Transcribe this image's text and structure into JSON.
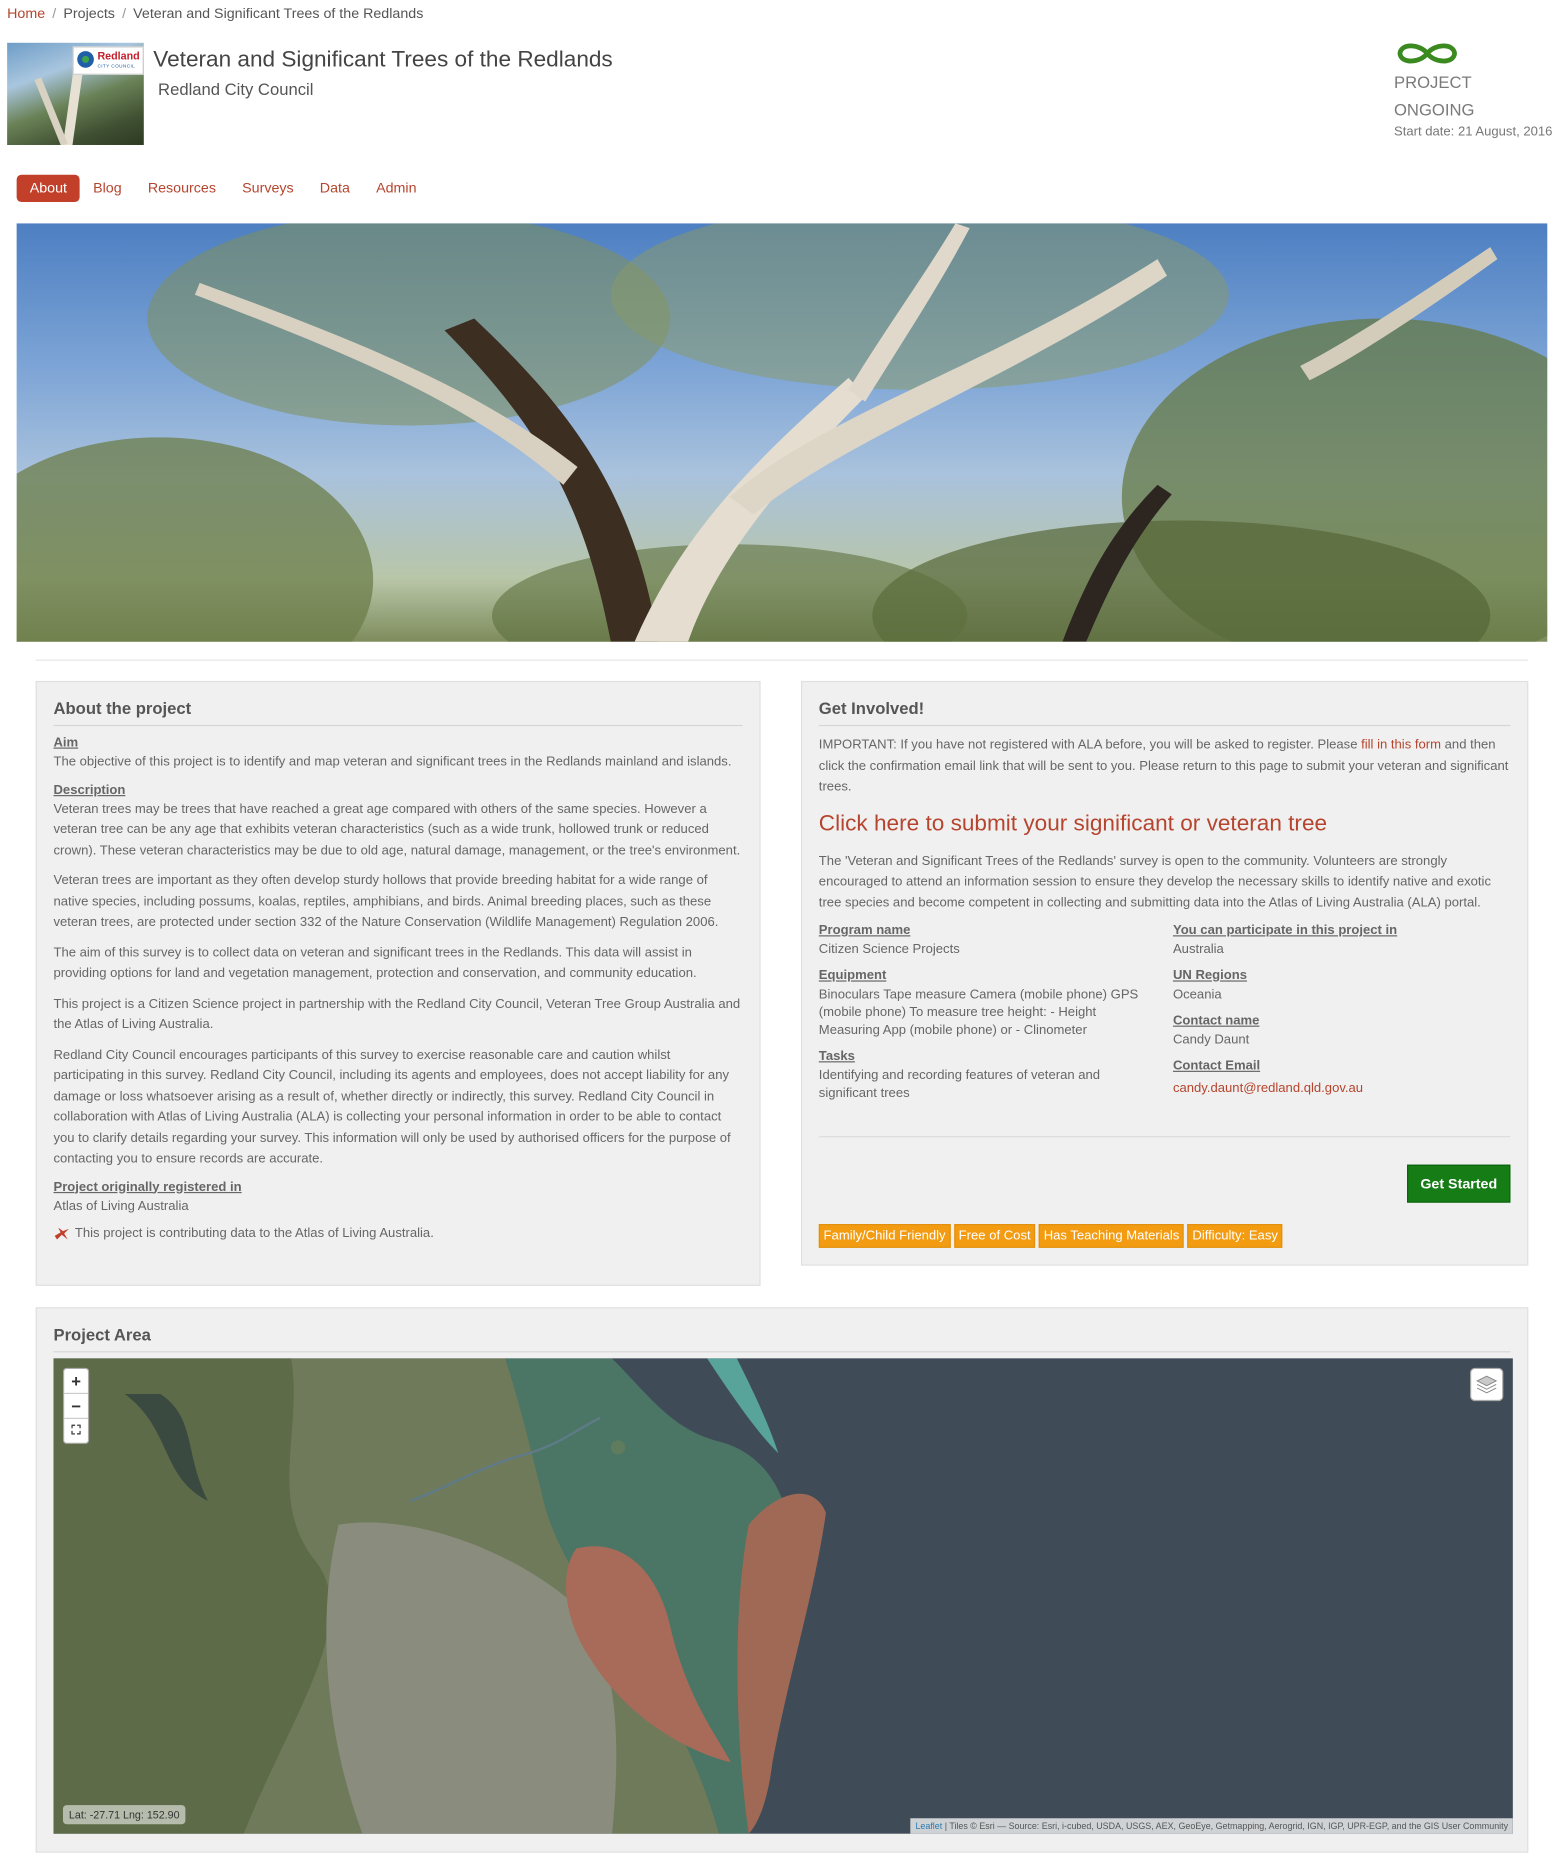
{
  "breadcrumb": {
    "home": "Home",
    "projects": "Projects",
    "current": "Veteran and Significant Trees of the Redlands"
  },
  "logo": {
    "brand_line1": "Redland",
    "brand_line2": "CITY COUNCIL"
  },
  "project": {
    "title": "Veteran and Significant Trees of the Redlands",
    "organisation": "Redland City Council"
  },
  "status": {
    "line1": "PROJECT",
    "line2": "ONGOING",
    "start_date": "Start date: 21 August, 2016",
    "icon": "infinity-icon",
    "color": "#3a8a1f"
  },
  "tabs": [
    "About",
    "Blog",
    "Resources",
    "Surveys",
    "Data",
    "Admin"
  ],
  "about": {
    "heading": "About the project",
    "aim_label": "Aim",
    "aim": "The objective of this project is to identify and map veteran and significant trees in the Redlands mainland and islands.",
    "description_label": "Description",
    "paragraphs": [
      "Veteran trees may be trees that have reached a great age compared with others of the same species. However a veteran tree can be any age that exhibits veteran characteristics (such as a wide trunk, hollowed trunk or reduced crown). These veteran characteristics may be due to old age, natural damage, management, or the tree's environment.",
      "Veteran trees are important as they often develop sturdy hollows that provide breeding habitat for a wide range of native species, including possums, koalas, reptiles, amphibians, and birds. Animal breeding places, such as these veteran trees, are protected under section 332 of the Nature Conservation (Wildlife Management) Regulation 2006.",
      "The aim of this survey is to collect data on veteran and significant trees in the Redlands. This data will assist in providing options for land and vegetation management, protection and conservation, and community education.",
      "This project is a Citizen Science project in partnership with the Redland City Council, Veteran Tree Group Australia and the Atlas of Living Australia.",
      "Redland City Council encourages participants of this survey to exercise reasonable care and caution whilst participating in this survey. Redland City Council, including its agents and employees, does not accept liability for any damage or loss whatsoever arising as a result of, whether directly or indirectly, this survey. Redland City Council in collaboration with Atlas of Living Australia (ALA) is collecting your personal information in order to be able to contact you to clarify details regarding your survey. This information will only be used by authorised officers for the purpose of contacting you to ensure records are accurate."
    ],
    "registered_label": "Project originally registered in",
    "registered_value": "Atlas of Living Australia",
    "contributing": "This project is contributing data to the Atlas of Living Australia."
  },
  "involved": {
    "heading": "Get Involved!",
    "important_before": "IMPORTANT: If you have not registered with ALA before, you will be asked to register. Please ",
    "important_link": "fill in this form",
    "important_after": " and then click the confirmation email link that will be sent to you. Please return to this page to submit your veteran and significant trees.",
    "submit_link": "Click here to submit your significant or veteran tree",
    "survey_text": "The 'Veteran and Significant Trees of the Redlands' survey is open to the community. Volunteers are strongly encouraged to attend an information session to ensure they develop the necessary skills to identify native and exotic tree species and become competent in collecting and submitting data into the Atlas of Living Australia (ALA) portal.",
    "program_label": "Program name",
    "program_value": "Citizen Science Projects",
    "equipment_label": "Equipment",
    "equipment_value": "Binoculars Tape measure Camera (mobile phone) GPS (mobile phone) To measure tree height: - Height Measuring App (mobile phone) or - Clinometer",
    "tasks_label": "Tasks",
    "tasks_value": "Identifying and recording features of veteran and significant trees",
    "participate_label": "You can participate in this project in",
    "participate_value": "Australia",
    "un_label": "UN Regions",
    "un_value": "Oceania",
    "contact_name_label": "Contact name",
    "contact_name_value": "Candy Daunt",
    "contact_email_label": "Contact Email",
    "contact_email_value": "candy.daunt@redland.qld.gov.au",
    "get_started": "Get Started",
    "tags": [
      "Family/Child Friendly",
      "Free of Cost",
      "Has Teaching Materials",
      "Difficulty: Easy"
    ],
    "tag_color": "#f39c12",
    "button_color": "#167d16"
  },
  "area": {
    "heading": "Project Area",
    "zoom_in": "+",
    "zoom_out": "−",
    "coords": "Lat: -27.71 Lng: 152.90",
    "attribution_link": "Leaflet",
    "attribution_text": " | Tiles © Esri — Source: Esri, i-cubed, USDA, USGS, AEX, GeoEye, Getmapping, Aerogrid, IGN, IGP, UPR-EGP, and the GIS User Community"
  }
}
